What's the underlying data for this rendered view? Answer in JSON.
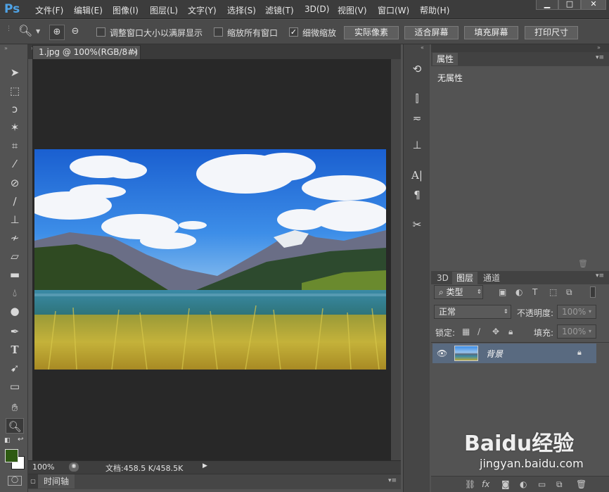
{
  "app": {
    "logo": "Ps"
  },
  "menu": [
    "文件(F)",
    "编辑(E)",
    "图像(I)",
    "图层(L)",
    "文字(Y)",
    "选择(S)",
    "滤镜(T)",
    "3D(D)",
    "视图(V)",
    "窗口(W)",
    "帮助(H)"
  ],
  "window_controls": {
    "minimize": "▁",
    "maximize": "□",
    "close": "✕"
  },
  "options": {
    "resize_windows": "调整窗口大小以满屏显示",
    "zoom_all": "缩放所有窗口",
    "scrubby_zoom": "细微缩放",
    "actual_pixels": "实际像素",
    "fit_screen": "适合屏幕",
    "fill_screen": "填充屏幕",
    "print_size": "打印尺寸",
    "checkbox_states": {
      "resize_windows": false,
      "zoom_all": false,
      "scrubby_zoom": true
    }
  },
  "document": {
    "tab_title": "1.jpg @ 100%(RGB/8#)",
    "tab_close": "×",
    "zoom": "100%",
    "doc_info": "文档:458.5 K/458.5K"
  },
  "timeline": {
    "label": "时间轴"
  },
  "properties": {
    "tab": "属性",
    "content": "无属性"
  },
  "layers": {
    "tabs": [
      "3D",
      "图层",
      "通道"
    ],
    "filter_kind": "类型",
    "blend_mode": "正常",
    "opacity_label": "不透明度:",
    "opacity_value": "100%",
    "lock_label": "锁定:",
    "fill_label": "填充:",
    "fill_value": "100%",
    "items": [
      {
        "name": "背景",
        "visible": true,
        "locked": true
      }
    ],
    "bottom_icons": [
      "link-icon",
      "fx-icon",
      "mask-icon",
      "adjustment-icon",
      "folder-icon",
      "new-layer-icon",
      "trash-icon"
    ]
  },
  "watermark": {
    "text": "Baidu经验",
    "url": "jingyan.baidu.com"
  },
  "colors": {
    "foreground": "#2e5a12",
    "background": "#ffffff",
    "accent": "#4fa3e6"
  }
}
